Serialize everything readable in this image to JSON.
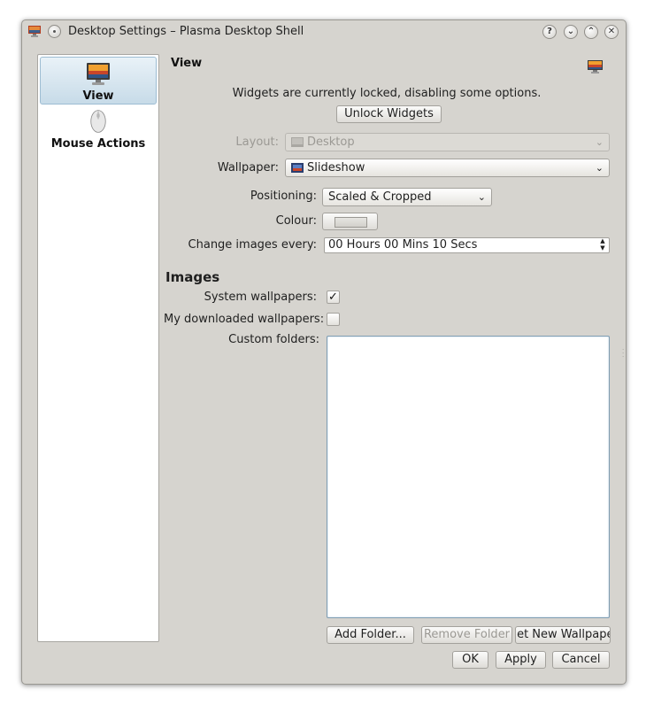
{
  "window": {
    "title": "Desktop Settings – Plasma Desktop Shell",
    "title_buttons": [
      {
        "name": "help-button",
        "glyph": "?"
      },
      {
        "name": "minimize-button",
        "glyph": "⌄"
      },
      {
        "name": "maximize-button",
        "glyph": "⌃"
      },
      {
        "name": "close-button",
        "glyph": "✕"
      }
    ]
  },
  "sidebar": {
    "items": [
      {
        "label": "View",
        "icon": "monitor-wallpaper-icon",
        "selected": true
      },
      {
        "label": "Mouse Actions",
        "icon": "mouse-icon",
        "selected": false
      }
    ]
  },
  "page": {
    "heading": "View",
    "lock_message": "Widgets are currently locked, disabling some options.",
    "unlock_button": "Unlock Widgets"
  },
  "form": {
    "layout": {
      "label": "Layout:",
      "value": "Desktop",
      "enabled": false
    },
    "wallpaper": {
      "label": "Wallpaper:",
      "value": "Slideshow"
    },
    "positioning": {
      "label": "Positioning:",
      "value": "Scaled & Cropped"
    },
    "colour": {
      "label": "Colour:"
    },
    "change_images": {
      "label": "Change images every:",
      "value": "00 Hours 00 Mins 10 Secs"
    }
  },
  "images": {
    "heading": "Images",
    "system_wallpapers": {
      "label": "System wallpapers:",
      "checked": true
    },
    "downloaded_wallpapers": {
      "label": "My downloaded wallpapers:",
      "checked": false
    },
    "custom_folders": {
      "label": "Custom folders:"
    },
    "add_folder": "Add Folder...",
    "remove_folder": "Remove Folder",
    "get_new": "Get New Wallpapers"
  },
  "dialog_buttons": {
    "ok": "OK",
    "apply": "Apply",
    "cancel": "Cancel"
  },
  "colors": {
    "window_bg": "#d6d4cf",
    "selection": "#c7dbe8",
    "list_border": "#7f9db3"
  }
}
